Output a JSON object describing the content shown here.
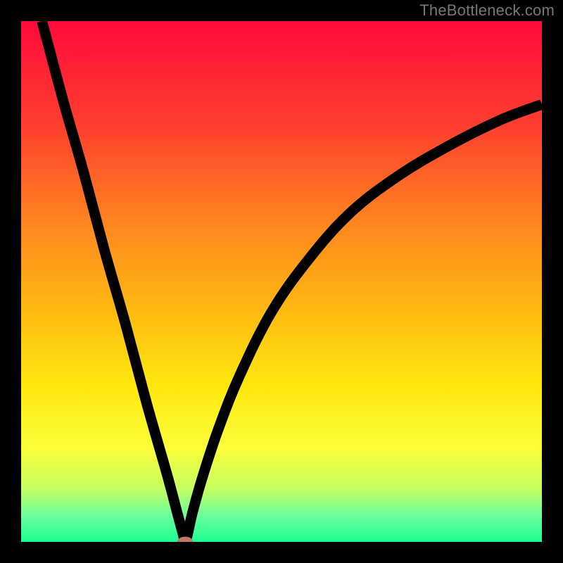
{
  "watermark": "TheBottleneck.com",
  "colors": {
    "frame": "#000000",
    "gradient_stops": [
      {
        "offset": 0.0,
        "color": "#ff0b3a"
      },
      {
        "offset": 0.2,
        "color": "#ff3e2f"
      },
      {
        "offset": 0.4,
        "color": "#ff8a1e"
      },
      {
        "offset": 0.55,
        "color": "#ffb812"
      },
      {
        "offset": 0.7,
        "color": "#ffe70d"
      },
      {
        "offset": 0.82,
        "color": "#fcff3a"
      },
      {
        "offset": 0.9,
        "color": "#c3ff62"
      },
      {
        "offset": 0.95,
        "color": "#6bff9c"
      },
      {
        "offset": 1.0,
        "color": "#1aff8f"
      }
    ],
    "curve": "#000000",
    "marker": "#c47763"
  },
  "chart_data": {
    "type": "line",
    "title": "",
    "xlabel": "",
    "ylabel": "",
    "xlim": [
      0,
      100
    ],
    "ylim": [
      0,
      100
    ],
    "legend": false,
    "grid": false,
    "notes": "Bottleneck-style V curve; minimum at x≈31.5 touches y≈0. Left branch nearly linear to top-left corner; right branch asymptotic toward ~84% at right edge.",
    "series": [
      {
        "name": "curve",
        "x": [
          4,
          8,
          12,
          16,
          20,
          24,
          28,
          30,
          31,
          31.5,
          32,
          33,
          35,
          38,
          42,
          48,
          55,
          63,
          72,
          82,
          92,
          100
        ],
        "y": [
          100,
          85,
          71,
          56,
          42,
          27,
          13,
          5.5,
          1.8,
          0,
          1.6,
          6,
          13,
          22,
          32,
          44,
          54,
          63,
          70,
          76,
          81,
          84
        ]
      }
    ],
    "marker": {
      "x": 31.5,
      "y": 0,
      "rx": 1.5,
      "ry": 1.0
    }
  }
}
